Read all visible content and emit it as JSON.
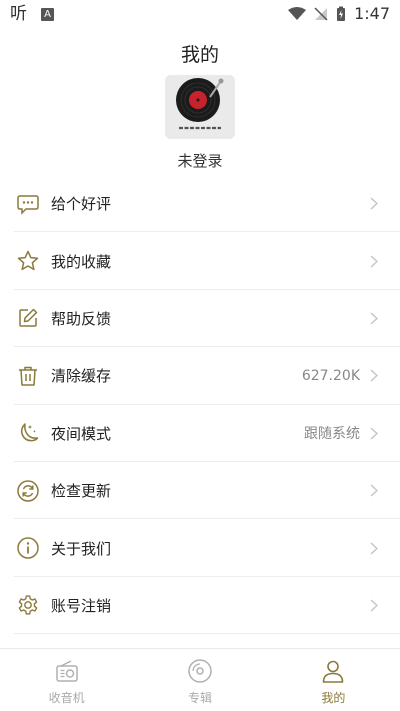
{
  "status_bar": {
    "app_glyph": "听",
    "notif_glyph": "A",
    "time": "1:47"
  },
  "header": {
    "title": "我的"
  },
  "profile": {
    "username": "未登录"
  },
  "menu": {
    "items": [
      {
        "label": "给个好评",
        "value": "",
        "icon": "chat-bubble-icon"
      },
      {
        "label": "我的收藏",
        "value": "",
        "icon": "star-icon"
      },
      {
        "label": "帮助反馈",
        "value": "",
        "icon": "edit-icon"
      },
      {
        "label": "清除缓存",
        "value": "627.20K",
        "icon": "trash-icon"
      },
      {
        "label": "夜间模式",
        "value": "跟随系统",
        "icon": "moon-icon"
      },
      {
        "label": "检查更新",
        "value": "",
        "icon": "refresh-icon"
      },
      {
        "label": "关于我们",
        "value": "",
        "icon": "info-icon"
      },
      {
        "label": "账号注销",
        "value": "",
        "icon": "gear-icon"
      }
    ]
  },
  "tabbar": {
    "tabs": [
      {
        "label": "收音机",
        "icon": "radio-icon",
        "active": false
      },
      {
        "label": "专辑",
        "icon": "disc-icon",
        "active": false
      },
      {
        "label": "我的",
        "icon": "person-icon",
        "active": true
      }
    ]
  },
  "colors": {
    "accent": "#8a7a3c",
    "icon": "#8a7a3c",
    "inactive": "#aaaaaa"
  }
}
